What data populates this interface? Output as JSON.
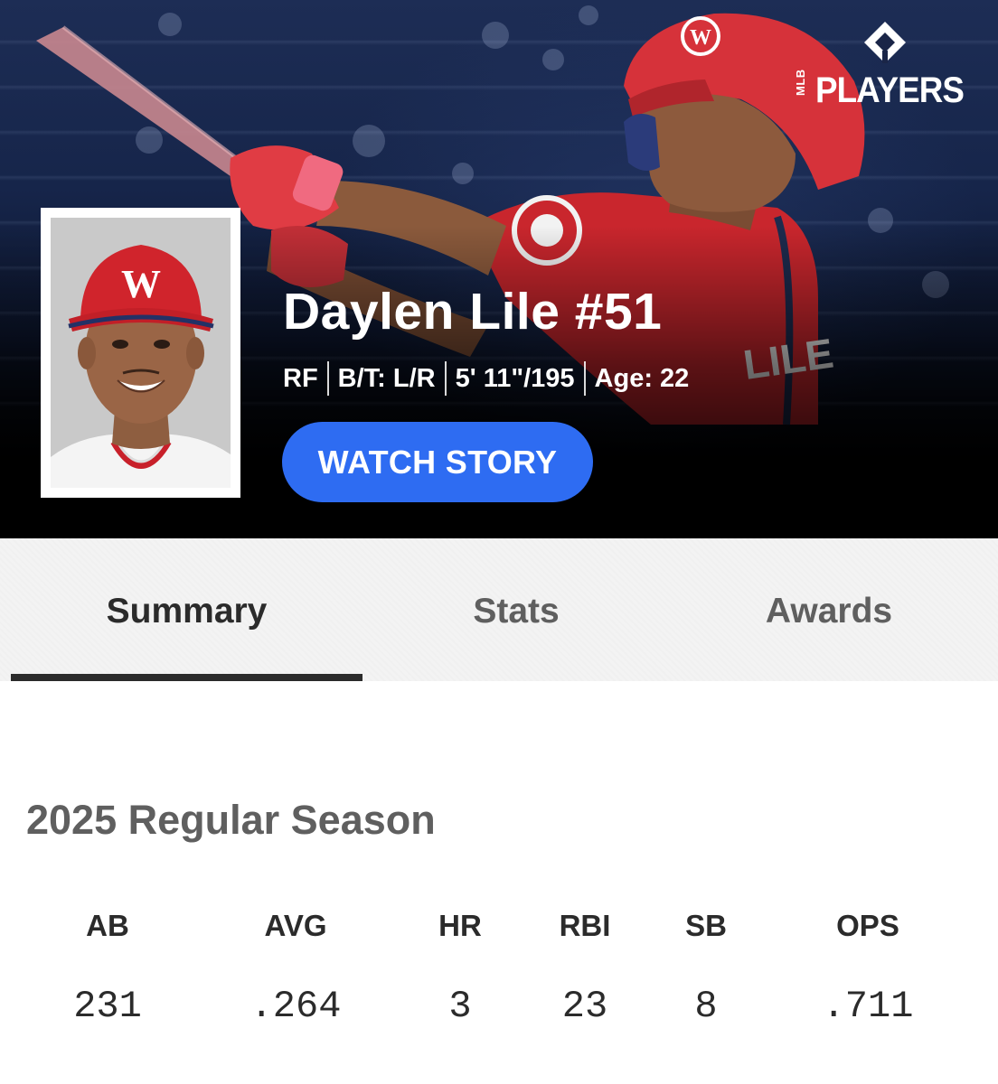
{
  "brand": {
    "mlb": "MLB",
    "players": "PLAYERS"
  },
  "player": {
    "name": "Daylen Lile #51",
    "position": "RF",
    "bats_throws": "B/T: L/R",
    "height_weight": "5' 11\"/195",
    "age": "Age: 22",
    "headshot_icon": "player-headshot-photo"
  },
  "hero": {
    "watch_story_label": "WATCH STORY",
    "accent_color": "#2e6cf2",
    "team_color": "#d42a33"
  },
  "tabs": [
    {
      "label": "Summary",
      "active": true
    },
    {
      "label": "Stats",
      "active": false
    },
    {
      "label": "Awards",
      "active": false
    }
  ],
  "season": {
    "title": "2025 Regular Season",
    "stats": [
      {
        "label": "AB",
        "value": "231"
      },
      {
        "label": "AVG",
        "value": ".264"
      },
      {
        "label": "HR",
        "value": "3"
      },
      {
        "label": "RBI",
        "value": "23"
      },
      {
        "label": "SB",
        "value": "8"
      },
      {
        "label": "OPS",
        "value": ".711"
      }
    ]
  }
}
